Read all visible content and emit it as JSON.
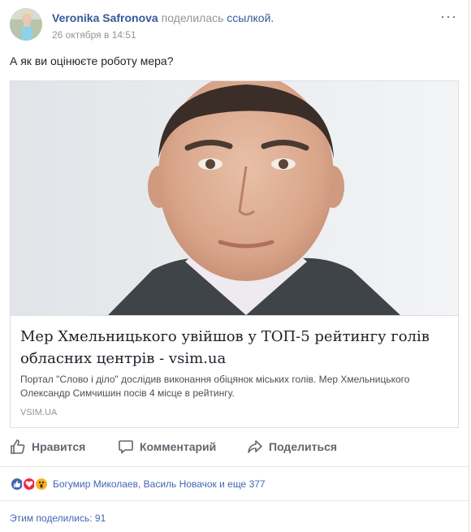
{
  "post": {
    "author_name": "Veronika Safronova",
    "shared_text": "поделилась",
    "shared_link_text": "ссылкой.",
    "timestamp": "26 октября в 14:51",
    "more_label": "···",
    "message": "А як ви оцінюєте роботу мера?"
  },
  "link_card": {
    "title": "Мер Хмельницького увійшов у ТОП-5 рейтингу голів обласних центрів - vsim.ua",
    "description": "Портал \"Слово і діло\" дослідив виконання обіцянок міських голів. Мер Хмельницького Олександр Симчишин посів 4 місце в рейтингу.",
    "domain": "VSIM.UA"
  },
  "actions": {
    "like_label": "Нравится",
    "comment_label": "Комментарий",
    "share_label": "Поделиться"
  },
  "reactions": {
    "icons": [
      "like-icon",
      "love-icon",
      "wow-icon"
    ],
    "text": "Богумир Миколаев, Василь Новачок и еще 377"
  },
  "shares": {
    "text": "Этим поделились: 91"
  },
  "colors": {
    "link_blue": "#365899",
    "reaction_blue": "#4267b2",
    "love_red": "#f0284a",
    "wow_yellow": "#f7b125",
    "muted_gray": "#90949c"
  }
}
